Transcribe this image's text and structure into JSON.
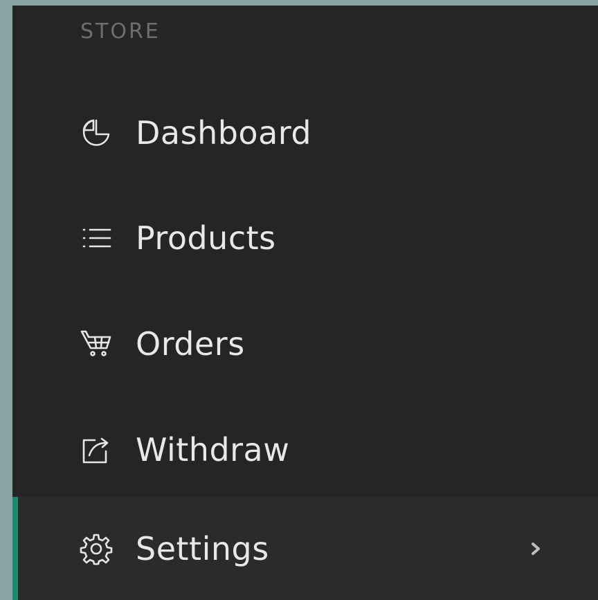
{
  "sidebar": {
    "section_label": "STORE",
    "items": [
      {
        "label": "Dashboard",
        "icon": "pie-chart-icon"
      },
      {
        "label": "Products",
        "icon": "list-icon"
      },
      {
        "label": "Orders",
        "icon": "cart-icon"
      },
      {
        "label": "Withdraw",
        "icon": "withdraw-icon"
      },
      {
        "label": "Settings",
        "icon": "gear-icon",
        "active": true,
        "has_submenu": true
      }
    ]
  },
  "colors": {
    "page_background": "#8aa3a5",
    "sidebar_background": "#252525",
    "active_background": "#2b2b2b",
    "active_accent": "#1f8a72",
    "item_text": "#e8e8e8",
    "section_text": "#6e6e6e"
  }
}
